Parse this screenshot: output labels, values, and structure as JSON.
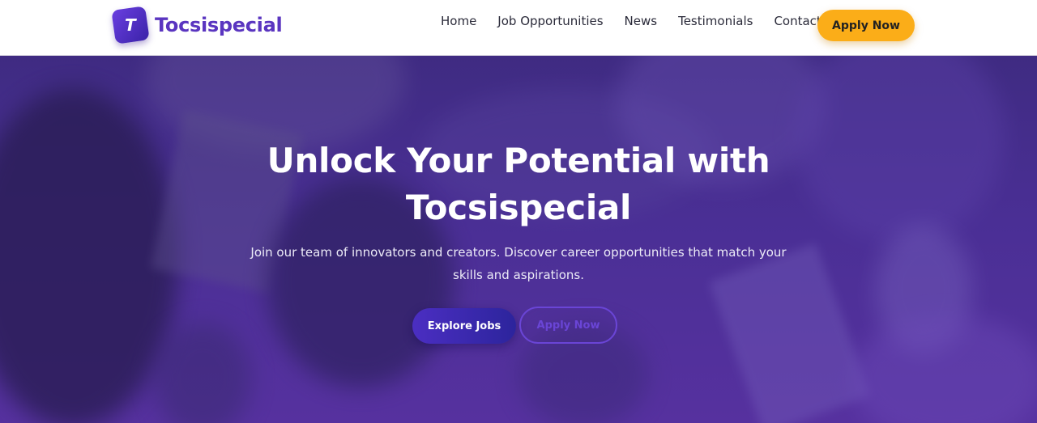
{
  "brand": {
    "name": "Tocsispecial",
    "icon_letter": "T",
    "icon": "tocsispecial-logo-icon"
  },
  "nav": {
    "links": [
      "Home",
      "Job Opportunities",
      "News",
      "Testimonials",
      "Contact"
    ],
    "cta_label": "Apply Now"
  },
  "hero": {
    "title_line1": "Unlock Your Potential with",
    "title_line2": "Tocsispecial",
    "subtitle": "Join our team of innovators and creators. Discover career opportunities that match your skills and aspirations.",
    "primary_button": "Explore Jobs",
    "secondary_button": "Apply Now"
  },
  "colors": {
    "brand": "#5a35c0",
    "accent": "#fbad18",
    "hero_overlay": "#4a2f95"
  }
}
